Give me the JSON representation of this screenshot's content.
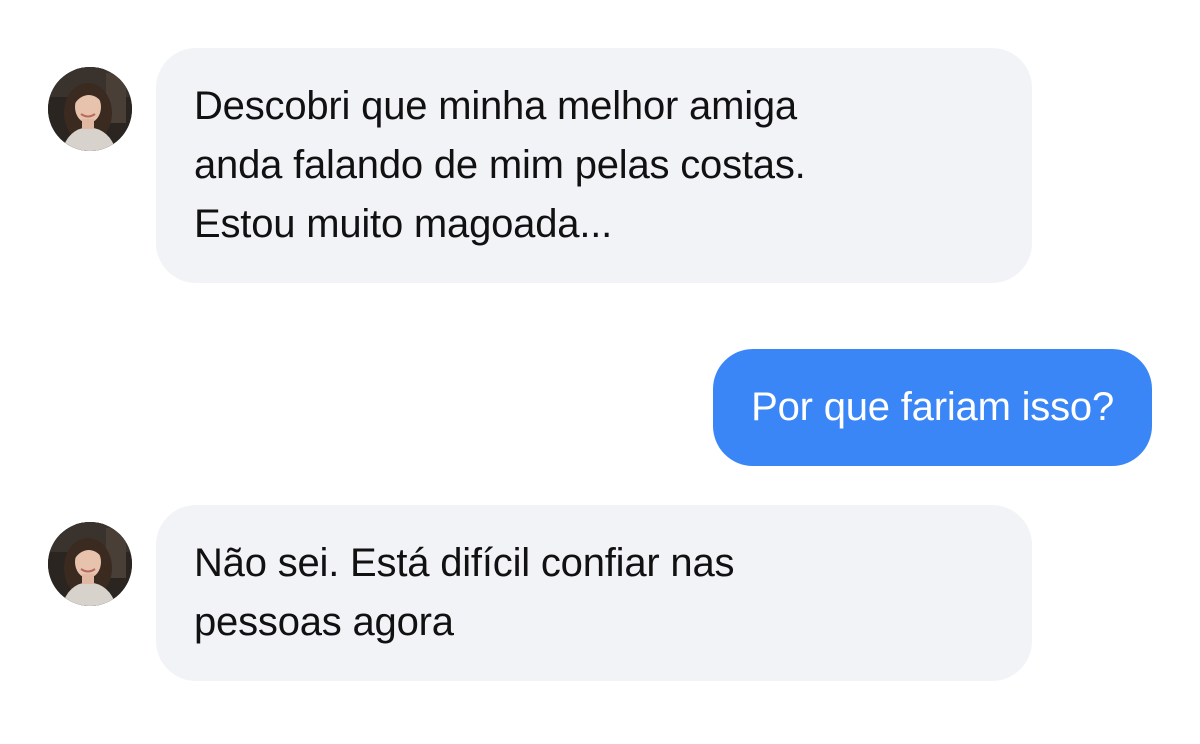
{
  "conversation": {
    "messages": [
      {
        "sender": "contact",
        "avatar_icon": "woman-portrait-avatar",
        "lines": [
          "Descobri que minha melhor amiga",
          "anda falando de mim pelas costas.",
          "Estou muito magoada..."
        ]
      },
      {
        "sender": "user",
        "lines": [
          "Por que fariam isso?"
        ]
      },
      {
        "sender": "contact",
        "avatar_icon": "woman-portrait-avatar",
        "lines": [
          "Não sei. Está difícil confiar nas",
          "pessoas agora"
        ]
      }
    ]
  },
  "colors": {
    "incoming_bubble": "#f2f3f7",
    "outgoing_bubble": "#3b86f6",
    "incoming_text": "#111111",
    "outgoing_text": "#ffffff",
    "background": "#ffffff"
  }
}
